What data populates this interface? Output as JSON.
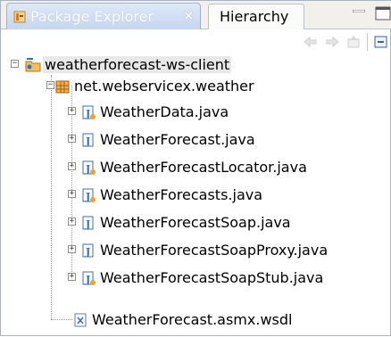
{
  "tabs": [
    {
      "label": "Package Explorer",
      "active": true
    },
    {
      "label": "Hierarchy",
      "active": false
    }
  ],
  "toolbar": {
    "icons": [
      "back-icon",
      "forward-icon",
      "up-icon",
      "collapse-all-icon",
      "link-with-editor-icon"
    ]
  },
  "tree": {
    "project": {
      "label": "weatherforecast-ws-client",
      "expanded": true
    },
    "package": {
      "label": "net.webservicex.weather",
      "expanded": true
    },
    "files": [
      {
        "label": "WeatherData.java",
        "kind": "class"
      },
      {
        "label": "WeatherForecast.java",
        "kind": "interface"
      },
      {
        "label": "WeatherForecastLocator.java",
        "kind": "class"
      },
      {
        "label": "WeatherForecasts.java",
        "kind": "class"
      },
      {
        "label": "WeatherForecastSoap.java",
        "kind": "interface"
      },
      {
        "label": "WeatherForecastSoapProxy.java",
        "kind": "class"
      },
      {
        "label": "WeatherForecastSoapStub.java",
        "kind": "class"
      }
    ],
    "wsdl": {
      "label": "WeatherForecast.asmx.wsdl"
    }
  },
  "colors": {
    "active_tab": "#c6d6ef",
    "java_icon": "#3b6fb5",
    "package_icon": "#c0781c",
    "project_icon": "#e8a33a"
  }
}
